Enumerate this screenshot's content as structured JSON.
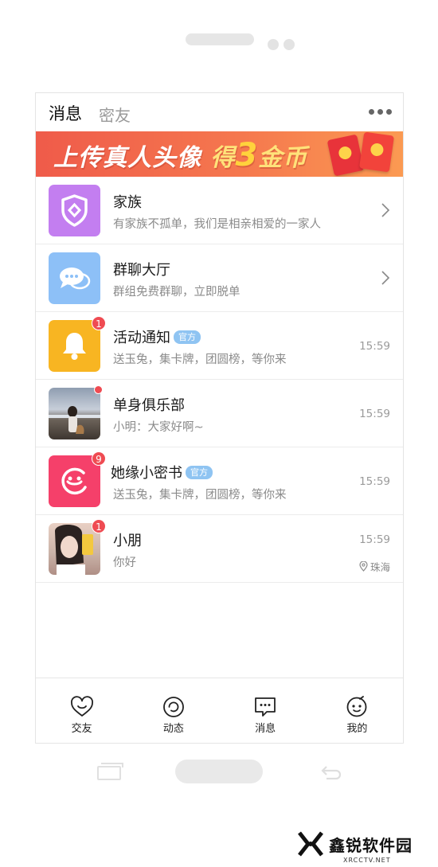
{
  "header": {
    "tab_messages": "消息",
    "tab_close_friends": "密友"
  },
  "banner": {
    "text_part1": "上传真人头像",
    "text_part2": "得",
    "text_big": "3",
    "text_part3": "金币"
  },
  "conversations": [
    {
      "name": "家族",
      "preview": "有家族不孤单，我们是相亲相爱的一家人"
    },
    {
      "name": "群聊大厅",
      "preview": "群组免费群聊，立即脱单"
    },
    {
      "name": "活动通知",
      "tag": "官方",
      "preview": "送玉兔，集卡牌，团圆榜，等你来",
      "time": "15:59",
      "badge": "1"
    },
    {
      "name": "单身俱乐部",
      "preview": "小明：大家好啊~",
      "time": "15:59"
    },
    {
      "name": "她缘小密书",
      "tag": "官方",
      "preview": "送玉兔，集卡牌，团圆榜，等你来",
      "time": "15:59",
      "badge": "9"
    },
    {
      "name": "小朋",
      "preview": "你好",
      "time": "15:59",
      "badge": "1",
      "location": "珠海"
    }
  ],
  "bottom_nav": [
    {
      "label": "交友",
      "icon": "heart-smile-icon"
    },
    {
      "label": "动态",
      "icon": "moment-icon"
    },
    {
      "label": "消息",
      "icon": "message-icon"
    },
    {
      "label": "我的",
      "icon": "face-icon"
    }
  ],
  "watermark": {
    "title": "鑫锐软件园",
    "sub": "XRCCTV.NET"
  },
  "colors": {
    "badge": "#ef4b52",
    "tag": "#8fc4f2",
    "banner_start": "#ef5b4a",
    "banner_end": "#fb9a52"
  }
}
